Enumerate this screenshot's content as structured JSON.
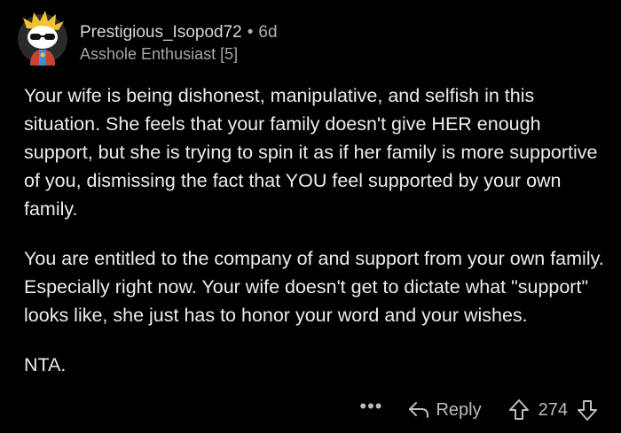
{
  "comment": {
    "username": "Prestigious_Isopod72",
    "separator": "•",
    "age": "6d",
    "flair": "Asshole Enthusiast [5]",
    "paragraphs": [
      "Your wife is being dishonest, manipulative, and selfish in this situation. She feels that your family doesn't give HER enough support, but she is trying to spin it as if her family is more supportive of you, dismissing the fact that YOU feel supported by your own family.",
      "You are entitled to the company of and support from your own family. Especially right now. Your wife doesn't get to dictate what \"support\" looks like, she just has to honor your word and your wishes.",
      "NTA."
    ]
  },
  "actions": {
    "more_label": "•••",
    "reply_label": "Reply",
    "score": "274"
  },
  "icons": {
    "avatar": "snoo-avatar-icon",
    "reply": "reply-arrow-icon",
    "upvote": "upvote-arrow-icon",
    "downvote": "downvote-arrow-icon"
  },
  "colors": {
    "background": "#000000",
    "text": "#ececec",
    "muted": "#a6a6a6"
  }
}
